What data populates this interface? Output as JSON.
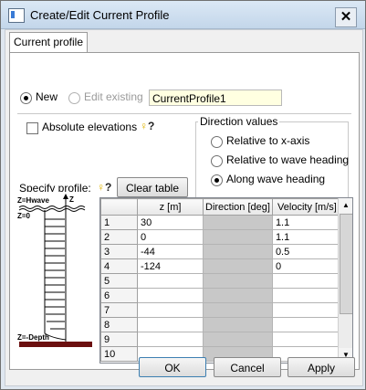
{
  "window": {
    "title": "Create/Edit Current Profile",
    "close_symbol": "✕"
  },
  "tab": {
    "label": "Current profile"
  },
  "mode": {
    "new_label": "New",
    "edit_label": "Edit existing",
    "name_value": "CurrentProfile1",
    "selected": "New"
  },
  "absolute_elevations": {
    "label": "Absolute elevations",
    "checked": false
  },
  "help_symbol": "?",
  "direction_values": {
    "title": "Direction values",
    "options": [
      "Relative to x-axis",
      "Relative to wave heading",
      "Along wave heading"
    ],
    "selected": "Along wave heading"
  },
  "specify_profile_label": "Specify profile:",
  "clear_table_label": "Clear table",
  "diagram": {
    "z_hwave": "Z=Hwave",
    "z_axis": "Z",
    "z_zero": "Z=0",
    "z_depth": "Z=-Depth"
  },
  "table": {
    "columns": [
      "",
      "z [m]",
      "Direction [deg]",
      "Velocity [m/s]"
    ],
    "rows": [
      [
        "1",
        "30",
        "",
        "1.1"
      ],
      [
        "2",
        "0",
        "",
        "1.1"
      ],
      [
        "3",
        "-44",
        "",
        "0.5"
      ],
      [
        "4",
        "-124",
        "",
        "0"
      ],
      [
        "5",
        "",
        "",
        ""
      ],
      [
        "6",
        "",
        "",
        ""
      ],
      [
        "7",
        "",
        "",
        ""
      ],
      [
        "8",
        "",
        "",
        ""
      ],
      [
        "9",
        "",
        "",
        ""
      ],
      [
        "10",
        "",
        "",
        ""
      ]
    ]
  },
  "buttons": {
    "ok": "OK",
    "cancel": "Cancel",
    "apply": "Apply"
  }
}
